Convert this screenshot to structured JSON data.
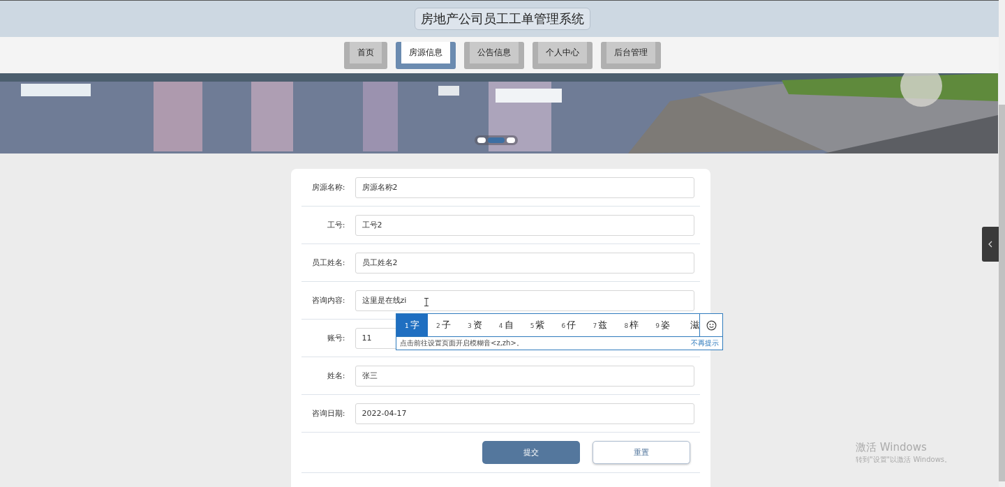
{
  "header": {
    "title": "房地产公司员工工单管理系统"
  },
  "nav": [
    {
      "label": "首页",
      "selected": false
    },
    {
      "label": "房源信息",
      "selected": true
    },
    {
      "label": "公告信息",
      "selected": false
    },
    {
      "label": "个人中心",
      "selected": false
    },
    {
      "label": "后台管理",
      "selected": false
    }
  ],
  "banner": {
    "dots": [
      {
        "selected": false
      },
      {
        "selected": true
      },
      {
        "selected": false
      }
    ]
  },
  "form": {
    "fields": [
      {
        "label": "房源名称:",
        "value": "房源名称2"
      },
      {
        "label": "工号:",
        "value": "工号2"
      },
      {
        "label": "员工姓名:",
        "value": "员工姓名2"
      },
      {
        "label": "咨询内容:",
        "value": "这里是在线zi"
      },
      {
        "label": "账号:",
        "value": "11"
      },
      {
        "label": "姓名:",
        "value": "张三"
      },
      {
        "label": "咨询日期:",
        "value": "2022-04-17"
      }
    ],
    "buttons": [
      {
        "label": "提交",
        "kind": "primary"
      },
      {
        "label": "重置",
        "kind": "secondary"
      }
    ]
  },
  "ime": {
    "candidates": [
      {
        "index": "1",
        "text": "字",
        "selected": true
      },
      {
        "index": "2",
        "text": "子",
        "selected": false
      },
      {
        "index": "3",
        "text": "资",
        "selected": false
      },
      {
        "index": "4",
        "text": "自",
        "selected": false
      },
      {
        "index": "5",
        "text": "紫",
        "selected": false
      },
      {
        "index": "6",
        "text": "仔",
        "selected": false
      },
      {
        "index": "7",
        "text": "兹",
        "selected": false
      },
      {
        "index": "8",
        "text": "梓",
        "selected": false
      },
      {
        "index": "9",
        "text": "姿",
        "selected": false
      },
      {
        "text": "滋",
        "selected": false
      }
    ],
    "hint": "点击前往设置页面开启模糊音<z,zh>。",
    "dismiss": "不再提示"
  },
  "activation": {
    "title": "激活 Windows",
    "subtitle": "转到\"设置\"以激活 Windows。"
  }
}
